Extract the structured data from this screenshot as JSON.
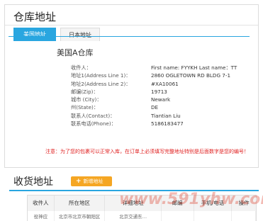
{
  "panel": {
    "title": "仓库地址",
    "tabs": [
      {
        "label": "美国地址",
        "active": true
      },
      {
        "label": "日本地址",
        "active": false
      }
    ],
    "warehouse_title": "美国A仓库",
    "address_rows": [
      {
        "label": "收件人：",
        "value": "First name: FYYKH Last name：TT"
      },
      {
        "label": "地址1(Address Line 1)：",
        "value": "2860 OGLETOWN RD BLDG 7-1"
      },
      {
        "label": "地址2(Address Line 2)：",
        "value": "#XA10061"
      },
      {
        "label": "邮编(Zip)：",
        "value": "19713"
      },
      {
        "label": "城市 (City)：",
        "value": "Newark"
      },
      {
        "label": "州(State)：",
        "value": "DE"
      },
      {
        "label": "联系人(Contact)：",
        "value": "Tiantian Liu"
      },
      {
        "label": "联系电话(Phone)：",
        "value": "5186183477"
      }
    ],
    "notice": "注意：为了您的包裹可以正常入库，在订单上必须填写完整地址特别是后面数字是您的编号！"
  },
  "shipping": {
    "title": "收货地址",
    "add_button_label": "新增地址",
    "table": {
      "headers": [
        "收件人",
        "所在地区",
        "详细地址",
        "邮编",
        "手机/电话",
        "操作"
      ],
      "rows": [
        [
          "役神应",
          "北京市北京市朝阳区",
          "北京交通东…",
          "",
          "",
          ""
        ]
      ]
    }
  },
  "watermark": "www.591yhw.com",
  "colors": {
    "accent": "#29a6e0",
    "add_button": "#f5a623",
    "notice": "#e02020"
  }
}
